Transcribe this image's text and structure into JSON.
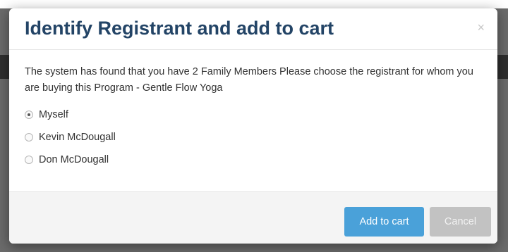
{
  "modal": {
    "title": "Identify Registrant and add to cart",
    "close_glyph": "×",
    "message": "The system has found that you have 2 Family Members Please choose the registrant for whom you are buying this Program - Gentle Flow Yoga",
    "options": [
      {
        "label": "Myself",
        "checked": true
      },
      {
        "label": "Kevin McDougall",
        "checked": false
      },
      {
        "label": "Don McDougall",
        "checked": false
      }
    ],
    "buttons": {
      "add_to_cart": "Add to cart",
      "cancel": "Cancel"
    }
  },
  "colors": {
    "title": "#234466",
    "primary_button": "#4aa1d9",
    "cancel_button": "#c2c2c2",
    "backdrop": "#6b6b6b"
  }
}
